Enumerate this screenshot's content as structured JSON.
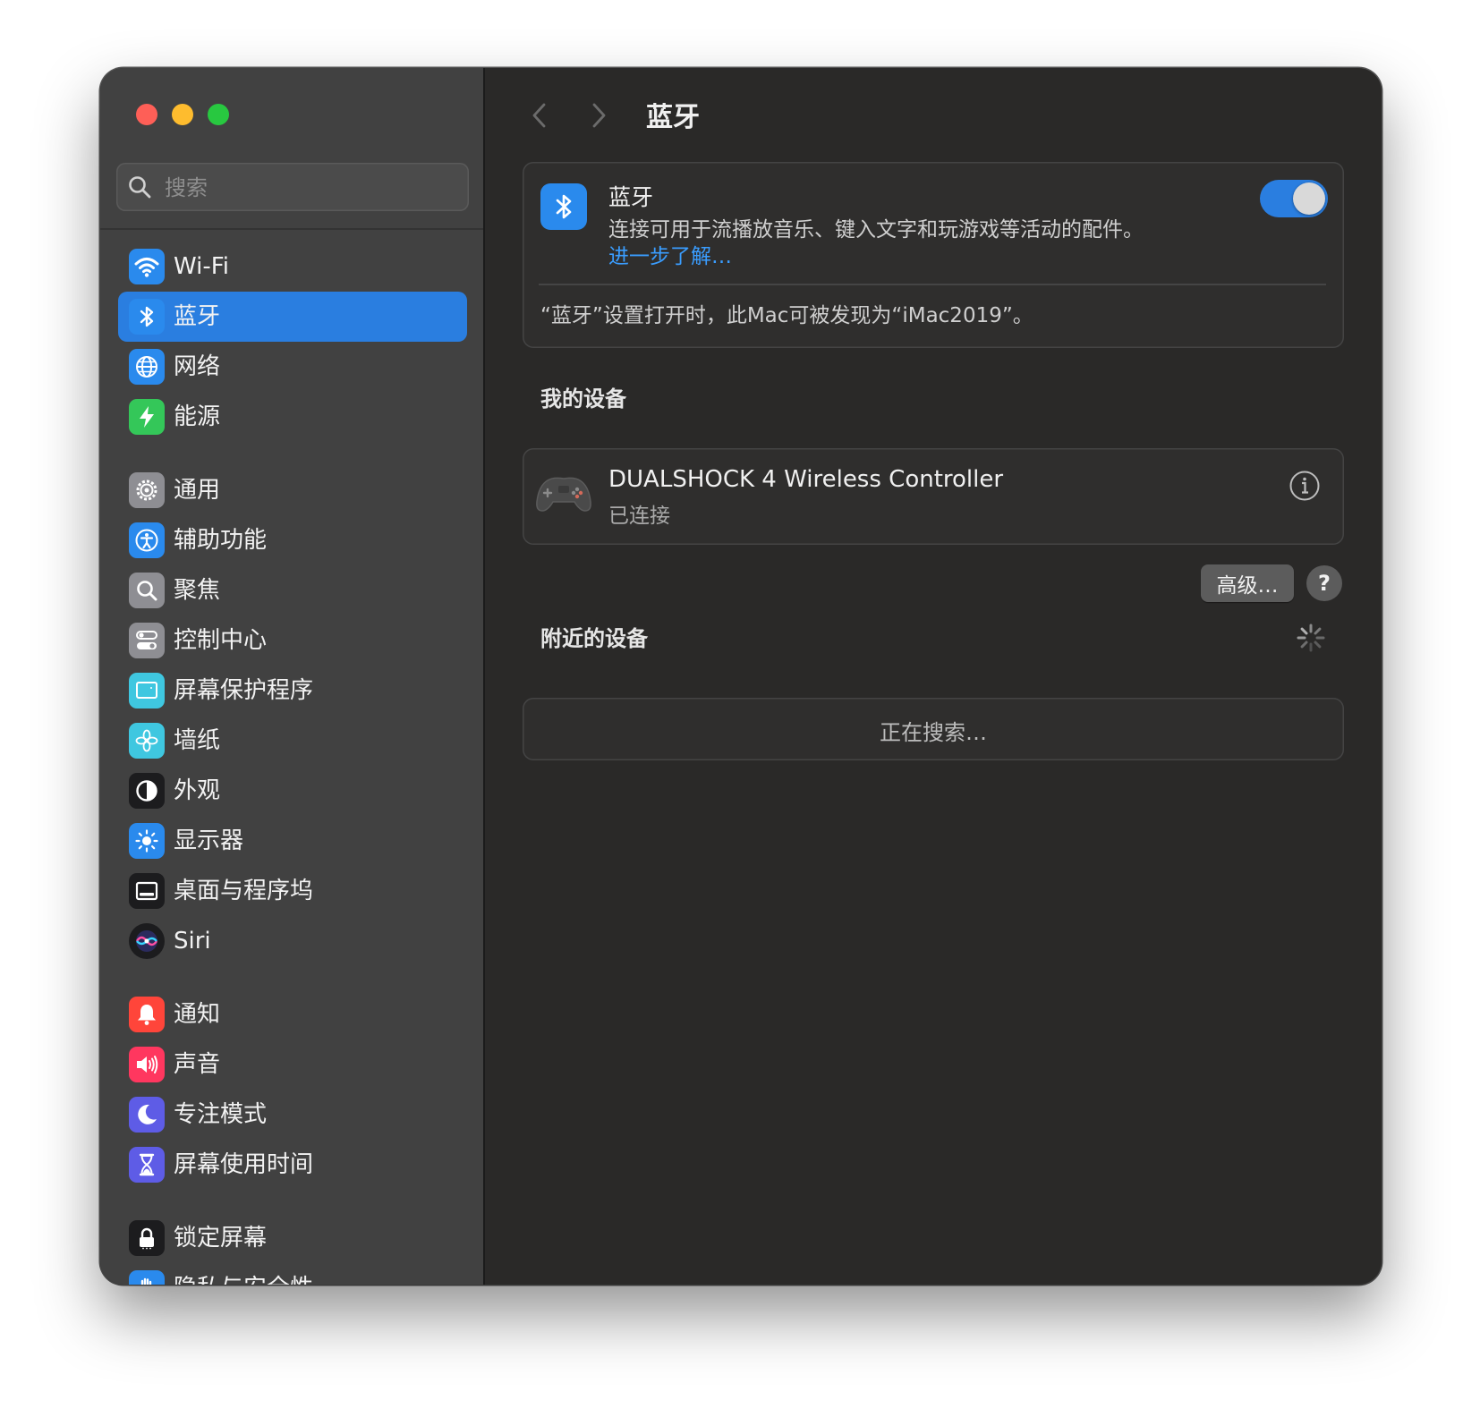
{
  "sidebar": {
    "search_placeholder": "搜索",
    "items": [
      {
        "label": "Wi-Fi",
        "icon": "wifi-icon",
        "color": "#2a8aed"
      },
      {
        "label": "蓝牙",
        "icon": "bluetooth-icon",
        "color": "#2a8aed",
        "selected": true
      },
      {
        "label": "网络",
        "icon": "globe-icon",
        "color": "#2a8aed"
      },
      {
        "label": "能源",
        "icon": "bolt-icon",
        "color": "#34c759"
      },
      {
        "label": "通用",
        "icon": "gear-icon",
        "color": "#8e8e93"
      },
      {
        "label": "辅助功能",
        "icon": "accessibility-icon",
        "color": "#2a8aed"
      },
      {
        "label": "聚焦",
        "icon": "magnifier-icon",
        "color": "#8e8e93"
      },
      {
        "label": "控制中心",
        "icon": "toggles-icon",
        "color": "#8e8e93"
      },
      {
        "label": "屏幕保护程序",
        "icon": "screensaver-icon",
        "color": "#3fc7e0"
      },
      {
        "label": "墙纸",
        "icon": "flower-icon",
        "color": "#3fc7e0"
      },
      {
        "label": "外观",
        "icon": "appearance-icon",
        "color": "#1c1c1e"
      },
      {
        "label": "显示器",
        "icon": "sun-icon",
        "color": "#2a8aed"
      },
      {
        "label": "桌面与程序坞",
        "icon": "dock-icon",
        "color": "#1c1c1e"
      },
      {
        "label": "Siri",
        "icon": "siri-icon",
        "color": "#2b2b5e"
      },
      {
        "label": "通知",
        "icon": "bell-icon",
        "color": "#ff453a"
      },
      {
        "label": "声音",
        "icon": "speaker-icon",
        "color": "#ff375f"
      },
      {
        "label": "专注模式",
        "icon": "moon-icon",
        "color": "#5e5ce6"
      },
      {
        "label": "屏幕使用时间",
        "icon": "hourglass-icon",
        "color": "#5e5ce6"
      },
      {
        "label": "锁定屏幕",
        "icon": "lock-icon",
        "color": "#1c1c1e"
      },
      {
        "label": "隐私与安全性",
        "icon": "hand-icon",
        "color": "#2a8aed"
      }
    ]
  },
  "main": {
    "title": "蓝牙",
    "bluetooth": {
      "title": "蓝牙",
      "description": "连接可用于流播放音乐、键入文字和玩游戏等活动的配件。",
      "link": "进一步了解…",
      "enabled": true,
      "note": "“蓝牙”设置打开时，此Mac可被发现为“iMac2019”。"
    },
    "my_devices": {
      "title": "我的设备",
      "devices": [
        {
          "name": "DUALSHOCK 4 Wireless Controller",
          "status": "已连接",
          "icon": "gamepad-icon"
        }
      ]
    },
    "advanced_label": "高级…",
    "help_label": "?",
    "nearby": {
      "title": "附近的设备",
      "status": "正在搜索…"
    }
  }
}
